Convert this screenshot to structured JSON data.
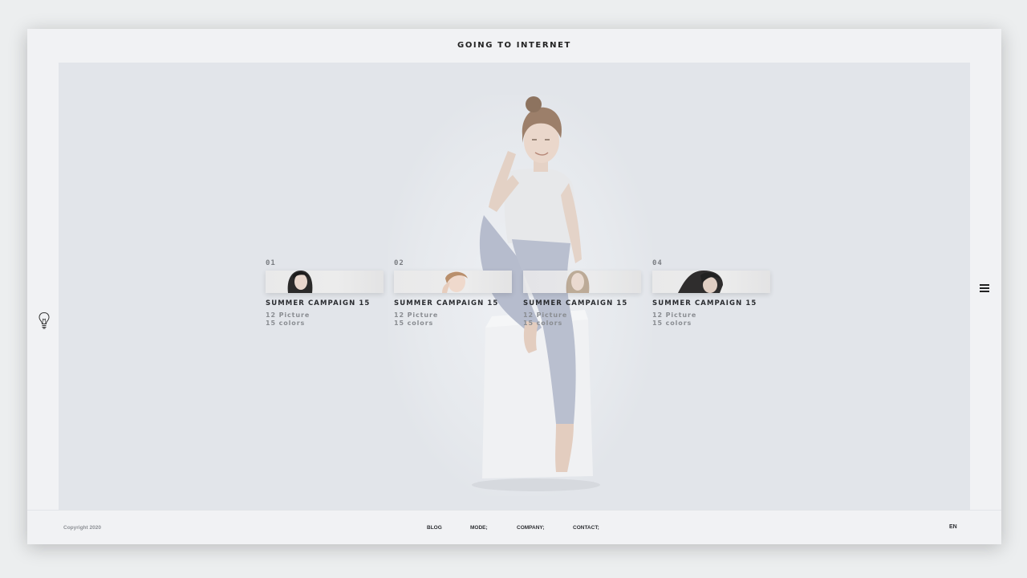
{
  "header": {
    "title": "GOING TO INTERNET"
  },
  "cards": [
    {
      "number": "01",
      "title": "SUMMER CAMPAIGN 15",
      "pictures": "12 Picture",
      "colors": "15 colors"
    },
    {
      "number": "02",
      "title": "SUMMER CAMPAIGN 15",
      "pictures": "12 Picture",
      "colors": "15 colors"
    },
    {
      "number": "",
      "title": "SUMMER CAMPAIGN 15",
      "pictures": "12 Picture",
      "colors": "15 colors"
    },
    {
      "number": "04",
      "title": "SUMMER CAMPAIGN 15",
      "pictures": "12 Picture",
      "colors": "15 colors"
    }
  ],
  "footer": {
    "copyright": "Copyright 2020",
    "nav": {
      "blog": "BLOG",
      "mode": "MODE;",
      "company": "COMPANY;",
      "contact": "CONTACT;"
    },
    "language": "EN"
  },
  "icons": {
    "left": "lightbulb-icon",
    "right": "hamburger-menu-icon"
  },
  "colors": {
    "frame": "#f1f2f4",
    "stage": "#e2e5ea",
    "text": "#222222",
    "muted": "#8a8d92"
  }
}
